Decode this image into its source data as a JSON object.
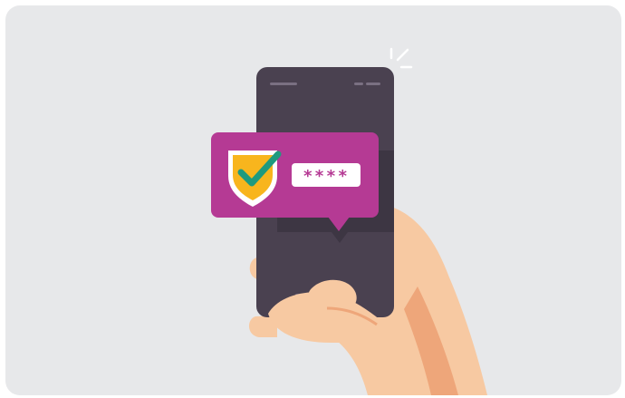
{
  "colors": {
    "background": "#e7e8ea",
    "phone": "#4a4150",
    "phone_shadow": "#3d3643",
    "bubble": "#b53a94",
    "shield": "#f8b51d",
    "shield_outline": "#ffffff",
    "check": "#1f9a7e",
    "skin": "#f7c9a2",
    "skin_shadow": "#eea67a",
    "sparkle": "#ffffff"
  },
  "password_field": {
    "masked_value": "****"
  },
  "icons": {
    "shield": "shield-check-icon",
    "sparkle": "notification-sparkle-icon"
  }
}
